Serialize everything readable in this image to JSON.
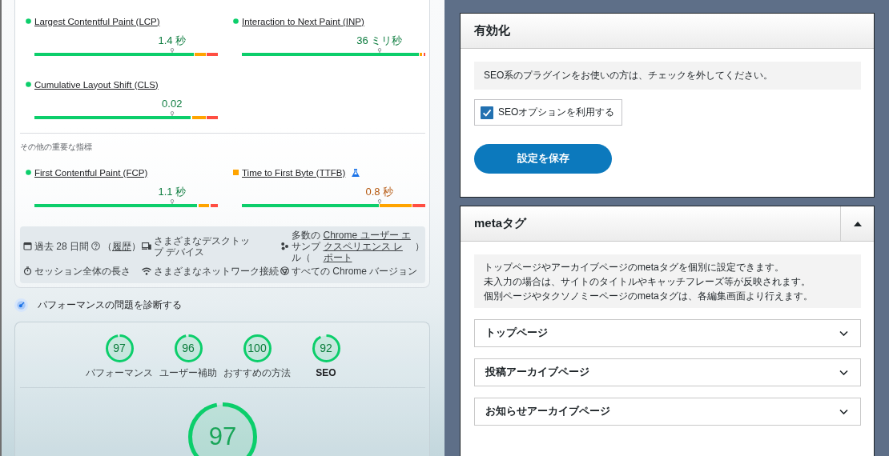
{
  "report": {
    "core_metrics": [
      {
        "name": "Largest Contentful Paint (LCP)",
        "kind": "good",
        "experimental": false,
        "value": "1.4 秒",
        "marker": {
          "level": 0.75
        }
      },
      {
        "name": "Interaction to Next Paint (INP)",
        "kind": "good",
        "experimental": false,
        "value": "36 ミリ秒",
        "marker": {
          "level": 0.75
        }
      },
      {
        "name": "Cumulative Layout Shift (CLS)",
        "kind": "good",
        "experimental": false,
        "value": "0.02",
        "marker": {
          "level": 0.75
        }
      }
    ],
    "other_metrics": {
      "heading": "その他の重要な指標",
      "metrics": [
        {
          "name": "First Contentful Paint (FCP)",
          "kind": "good",
          "experimental": false,
          "value": "1.1 秒",
          "marker": {
            "level": 0.75
          }
        },
        {
          "name": "Time to First Byte (TTFB)",
          "kind": "average",
          "experimental": true,
          "value": "0.8 秒",
          "marker": {
            "level": 0.75
          }
        }
      ]
    },
    "field_info": {
      "period": "過去 28 日間",
      "history": {
        "open": "（",
        "link": "履歴",
        "close": "）"
      },
      "devices": "さまざまなデスクトップ デバイス",
      "samples": {
        "text": "多数のサンプル（",
        "link": "Chrome ユーザー エクスペリエンス レポート",
        "close": "）"
      },
      "duration": "セッション全体の長さ",
      "network": "さまざまなネットワーク接続",
      "versions": "すべての Chrome バージョン"
    },
    "diagnose": {
      "heading": "パフォーマンスの問題を診断する",
      "categories": [
        {
          "score": "97",
          "label": "パフォーマンス",
          "selected": false
        },
        {
          "score": "96",
          "label": "ユーザー補助",
          "selected": false
        },
        {
          "score": "100",
          "label": "おすすめの方法",
          "selected": false
        },
        {
          "score": "92",
          "label": "SEO",
          "selected": true
        }
      ],
      "main_score": {
        "score": "97"
      }
    }
  },
  "settings": {
    "activation": {
      "title": "有効化",
      "notice": "SEO系のプラグインをお使いの方は、チェックを外してください。",
      "option": {
        "label": "SEOオプションを利用する",
        "checked": true
      },
      "save_button": "設定を保存"
    },
    "meta_tags": {
      "title": "metaタグ",
      "expanded": true,
      "notice_lines": [
        "トップページやアーカイブページのmetaタグを個別に設定できます。",
        "未入力の場合は、サイトのタイトルやキャッチフレーズ等が反映されます。",
        "個別ページやタクソノミーページのmetaタグは、各編集画面より行えます。"
      ],
      "sections": [
        {
          "label": "トップページ",
          "expanded": false
        },
        {
          "label": "投稿アーカイブページ",
          "expanded": false
        },
        {
          "label": "お知らせアーカイブページ",
          "expanded": false
        }
      ]
    }
  }
}
